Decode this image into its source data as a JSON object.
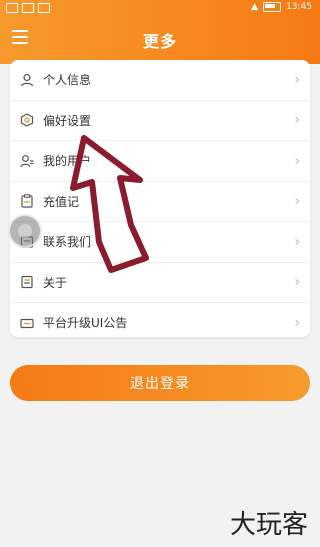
{
  "status_bar": {
    "time": "13:45"
  },
  "header": {
    "title": "更多"
  },
  "menu": {
    "items": [
      {
        "label": "个人信息",
        "icon": "user-icon"
      },
      {
        "label": "偏好设置",
        "icon": "settings-hex-icon"
      },
      {
        "label": "我的用户",
        "icon": "users-icon"
      },
      {
        "label": "充值记",
        "icon": "recharge-icon"
      },
      {
        "label": "联系我们",
        "icon": "contact-icon"
      },
      {
        "label": "关于",
        "icon": "about-icon"
      },
      {
        "label": "平台升级UI公告",
        "icon": "notice-icon"
      }
    ],
    "chevron": "›"
  },
  "logout": {
    "label": "退出登录"
  },
  "watermark": {
    "text": "大玩客"
  },
  "colors": {
    "accent": "#f57a14",
    "arrow": "#8b1c2c"
  }
}
